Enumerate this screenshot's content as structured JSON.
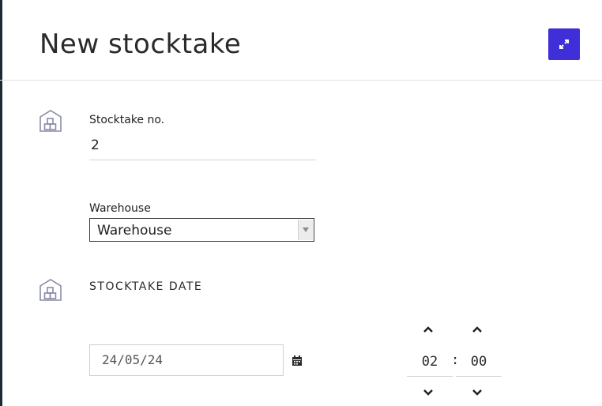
{
  "page": {
    "title": "New stocktake"
  },
  "header": {
    "expand_icon": "expand-arrows-icon",
    "accent_color": "#3f2fd8"
  },
  "form": {
    "stocktake_no": {
      "label": "Stocktake no.",
      "value": "2"
    },
    "warehouse": {
      "label": "Warehouse",
      "selected": "Warehouse"
    },
    "stocktake_date": {
      "heading": "STOCKTAKE DATE",
      "date_value": "24/05/24",
      "hour": "02",
      "minute": "00",
      "separator": ":"
    }
  },
  "icons": {
    "section_icon": "warehouse-boxes-icon",
    "calendar_icon": "calendar-icon",
    "up_icon": "chevron-up-icon",
    "down_icon": "chevron-down-icon"
  }
}
